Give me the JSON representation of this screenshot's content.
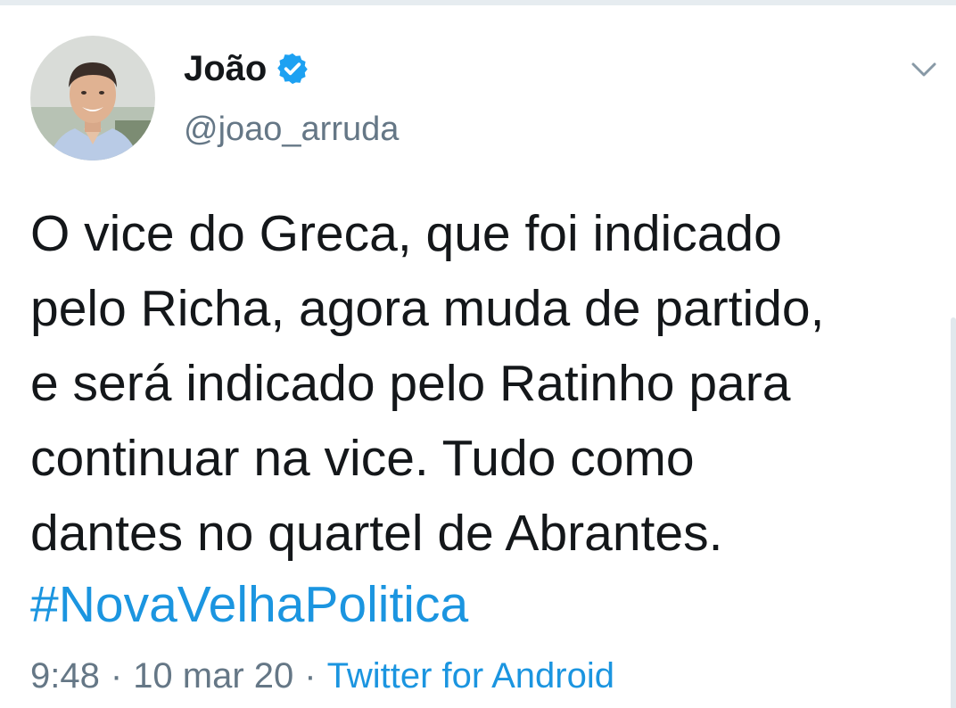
{
  "tweet": {
    "author": {
      "display_name": "João",
      "username": "@joao_arruda",
      "verified": true
    },
    "text": "O vice do Greca, que foi indicado\npelo Richa, agora muda de partido,\ne será indicado pelo Ratinho para\ncontinuar na vice. Tudo como\ndantes no quartel de Abrantes.",
    "hashtag": "#NovaVelhaPolitica",
    "time": "9:48",
    "date": "10 mar 20",
    "separator": "·",
    "source": "Twitter for Android"
  },
  "icons": {
    "verified": "verified-badge-icon",
    "caret": "chevron-down-icon"
  },
  "colors": {
    "text_primary": "#14171a",
    "text_secondary": "#657786",
    "link_blue": "#1b95e0",
    "verified_blue": "#1da1f2"
  }
}
